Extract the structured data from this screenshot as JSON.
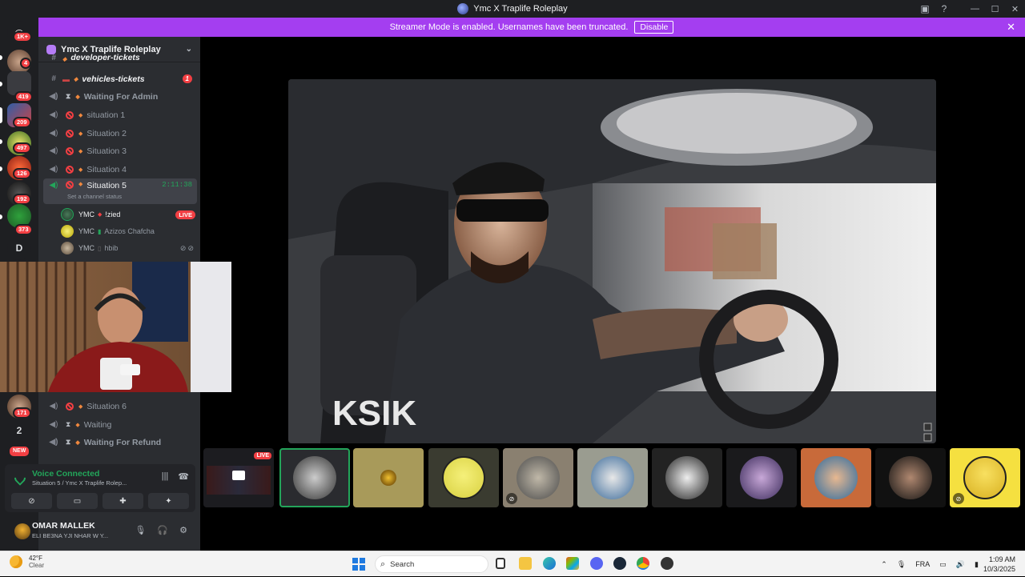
{
  "window": {
    "title": "Ymc X Traplife Roleplay"
  },
  "banner": {
    "text": "Streamer Mode is enabled. Usernames have been truncated.",
    "button": "Disable"
  },
  "servers": {
    "home_badge": "1K+",
    "badges": [
      "4",
      "419",
      "209",
      "497",
      "126",
      "192",
      "373"
    ],
    "letter": "D",
    "bottom_badge": "171",
    "count": "2",
    "new": "NEW"
  },
  "guild": {
    "name": "Ymc X Traplife Roleplay"
  },
  "channels": {
    "partial": "developer-tickets",
    "vehicles": {
      "name": "vehicles-tickets",
      "unread": "1"
    },
    "waiting_admin": "Waiting For Admin",
    "s1": "situation 1",
    "s2": "Situation 2",
    "s3": "Situation 3",
    "s4": "Situation 4",
    "s5": {
      "name": "Situation 5",
      "timer": "2:11:38",
      "status": "Set a channel status"
    },
    "s6": "Situation 6",
    "waiting": "Waiting",
    "waiting_refund": "Waiting For Refund"
  },
  "voice_users": [
    {
      "tag": "YMC",
      "name": "!zied",
      "live": "LIVE"
    },
    {
      "tag": "YMC",
      "name": "Azizos Chafcha"
    },
    {
      "tag": "YMC",
      "name": "hbib"
    }
  ],
  "voice_panel": {
    "title": "Voice Connected",
    "subtitle": "Situation 5 / Ymc X Traplife Rolep..."
  },
  "user": {
    "name": "OMAR MALLEK",
    "status": "ELI BE3NA YJI NHAR W Y..."
  },
  "tiles": {
    "live": "LIVE"
  },
  "taskbar": {
    "weather_temp": "42°F",
    "weather_cond": "Clear",
    "search": "Search",
    "lang": "FRA",
    "time": "1:09 AM",
    "date": "10/3/2025"
  }
}
